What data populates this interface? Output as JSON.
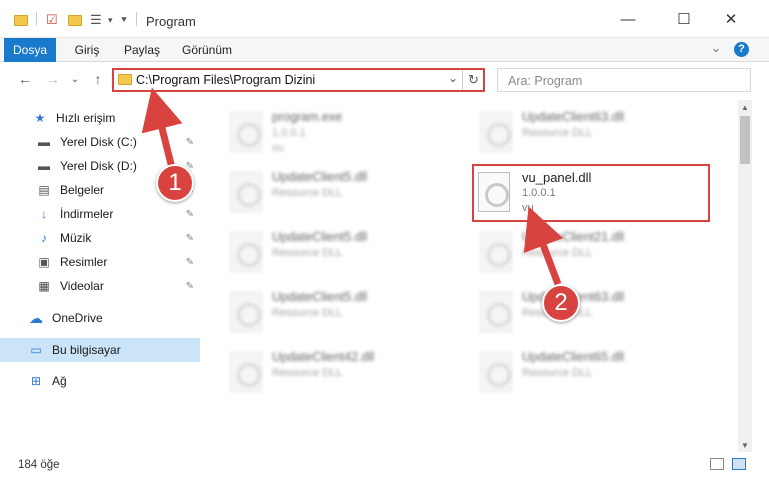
{
  "window": {
    "title": "Program",
    "minimize": "—",
    "maximize": "☐",
    "close": "✕"
  },
  "ribbon": {
    "tabs": [
      {
        "label": "Dosya"
      },
      {
        "label": "Giriş"
      },
      {
        "label": "Paylaş"
      },
      {
        "label": "Görünüm"
      }
    ],
    "expand": "⌄",
    "help": "?"
  },
  "nav": {
    "back": "←",
    "forward": "→",
    "recent": "⌄",
    "up": "↑",
    "address": "C:\\Program Files\\Program Dizini",
    "address_dropdown": "⌄",
    "refresh": "↻",
    "search_placeholder": "Ara: Program"
  },
  "sidebar": {
    "items": [
      {
        "label": "Hızlı erişim",
        "icon": "star-icon",
        "glyph": "★"
      },
      {
        "label": "Yerel Disk (C:)",
        "icon": "drive-icon",
        "glyph": "▬"
      },
      {
        "label": "Yerel Disk (D:)",
        "icon": "drive-icon",
        "glyph": "▬"
      },
      {
        "label": "Belgeler",
        "icon": "documents-icon",
        "glyph": "▤"
      },
      {
        "label": "İndirmeler",
        "icon": "download-icon",
        "glyph": "↓"
      },
      {
        "label": "Müzik",
        "icon": "music-icon",
        "glyph": "♪"
      },
      {
        "label": "Resimler",
        "icon": "pictures-icon",
        "glyph": "▣"
      },
      {
        "label": "Videolar",
        "icon": "videos-icon",
        "glyph": "▦"
      },
      {
        "label": "OneDrive",
        "icon": "cloud-icon",
        "glyph": "☁"
      },
      {
        "label": "Bu bilgisayar",
        "icon": "computer-icon",
        "glyph": "▭"
      },
      {
        "label": "Ağ",
        "icon": "network-icon",
        "glyph": "⊞"
      }
    ],
    "pin": "📌"
  },
  "files": {
    "left": [
      {
        "name": "program.exe",
        "line1": "1.0.0.1",
        "line2": "vu"
      },
      {
        "name": "UpdateClient5.dll",
        "line1": "Resource DLL"
      },
      {
        "name": "UpdateClient5.dll",
        "line1": "Resource DLL"
      },
      {
        "name": "UpdateClient5.dll",
        "line1": "Resource DLL"
      },
      {
        "name": "UpdateClient42.dll",
        "line1": "Resource DLL"
      }
    ],
    "right": [
      {
        "name": "UpdateClient63.dll",
        "line1": "Resource DLL"
      },
      {
        "name": "vu_panel.dll",
        "line1": "1.0.0.1",
        "line2": "vu"
      },
      {
        "name": "UpdateClient21.dll",
        "line1": "Resource DLL"
      },
      {
        "name": "UpdateClient63.dll",
        "line1": "Resource DLL"
      },
      {
        "name": "UpdateClient65.dll",
        "line1": "Resource DLL"
      }
    ]
  },
  "status": {
    "count": "184 öğe"
  },
  "annotations": {
    "badge1": "1",
    "badge2": "2",
    "color": "#d9433f"
  }
}
